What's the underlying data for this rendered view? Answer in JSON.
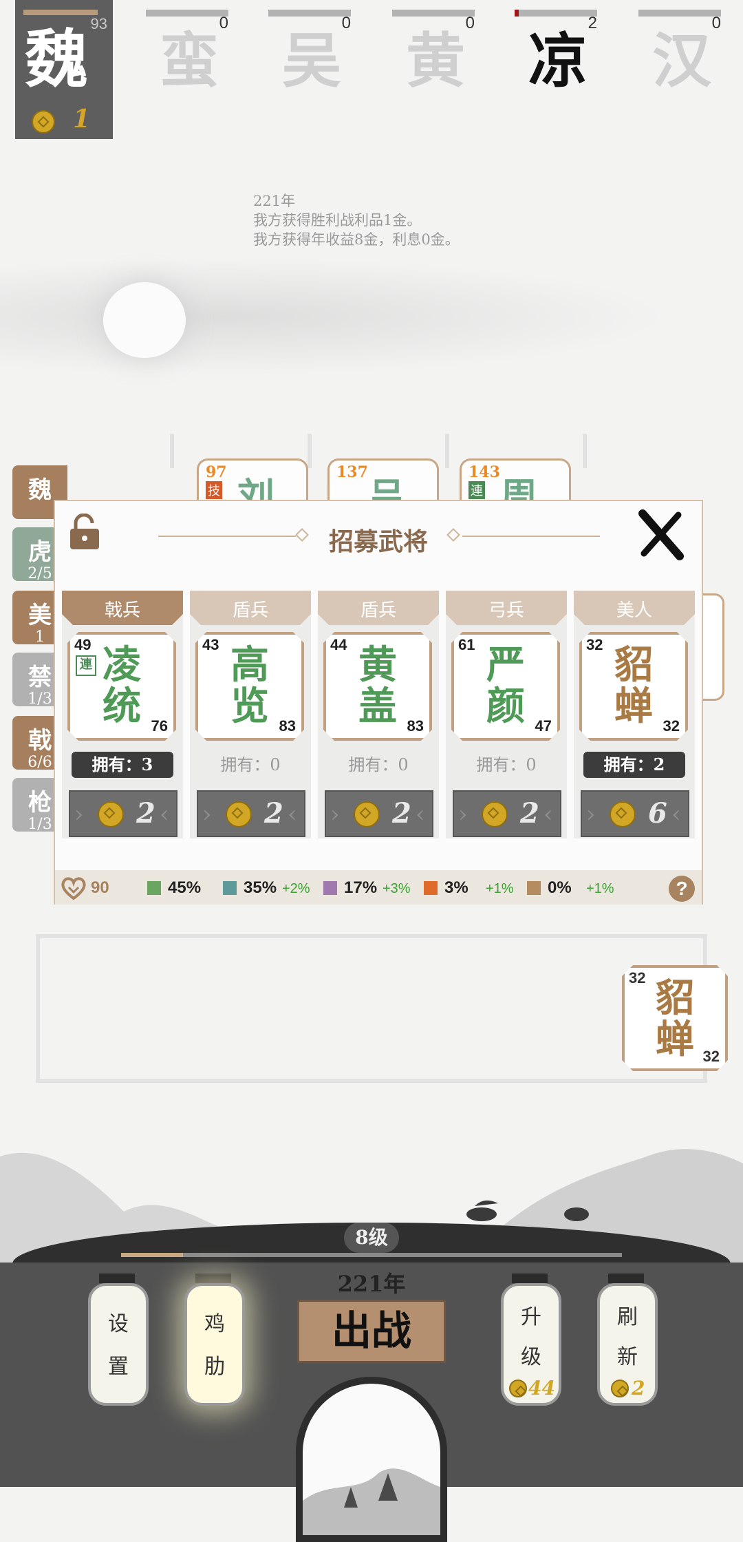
{
  "factions": [
    {
      "name": "魏",
      "hp": "93",
      "coins": "1",
      "active": true
    },
    {
      "name": "蛮",
      "hp": "0"
    },
    {
      "name": "吴",
      "hp": "0"
    },
    {
      "name": "黄",
      "hp": "0"
    },
    {
      "name": "凉",
      "hp": "2",
      "dark": true
    },
    {
      "name": "汉",
      "hp": "0"
    }
  ],
  "log": {
    "year": "221年",
    "line1": "我方获得胜利战利品1金。",
    "line2": "我方获得年收益8金，利息0金。"
  },
  "side_tags": [
    {
      "label": "魏",
      "sub": ""
    },
    {
      "label": "虎",
      "sub": "2/5"
    },
    {
      "label": "美",
      "sub": "1"
    },
    {
      "label": "禁",
      "sub": "1/3"
    },
    {
      "label": "戟",
      "sub": "6/6"
    },
    {
      "label": "枪",
      "sub": "1/3"
    }
  ],
  "bg_cards": [
    {
      "num": "97",
      "glyph": "刘",
      "badge": "技"
    },
    {
      "num": "137",
      "glyph": "吕"
    },
    {
      "num": "143",
      "glyph": "周",
      "badge": "連"
    }
  ],
  "modal": {
    "title": "招募武将",
    "generals": [
      {
        "type": "戟兵",
        "name1": "凌",
        "name2": "统",
        "atk": "49",
        "hp": "76",
        "badge": "連",
        "owned": "拥有：3",
        "has": true,
        "price": "2",
        "color": "#4f9a56",
        "ribbon": "#b08b6b"
      },
      {
        "type": "盾兵",
        "name1": "高",
        "name2": "览",
        "atk": "43",
        "hp": "83",
        "owned": "拥有：0",
        "has": false,
        "price": "2",
        "color": "#4f9a56",
        "ribbon": "#d8c7b7"
      },
      {
        "type": "盾兵",
        "name1": "黄",
        "name2": "盖",
        "atk": "44",
        "hp": "83",
        "owned": "拥有：0",
        "has": false,
        "price": "2",
        "color": "#4f9a56",
        "ribbon": "#d8c7b7"
      },
      {
        "type": "弓兵",
        "name1": "严",
        "name2": "颜",
        "atk": "61",
        "hp": "47",
        "owned": "拥有：0",
        "has": false,
        "price": "2",
        "color": "#4f9a56",
        "ribbon": "#d8c7b7"
      },
      {
        "type": "美人",
        "name1": "貂",
        "name2": "蝉",
        "atk": "32",
        "hp": "32",
        "owned": "拥有：2",
        "has": true,
        "price": "6",
        "color": "#a97a44",
        "ribbon": "#d8c7b7"
      }
    ],
    "footer": {
      "hearts": "90",
      "rates": [
        {
          "color": "#6aa661",
          "value": "45%",
          "plus": ""
        },
        {
          "color": "#5f9a9a",
          "value": "35%",
          "plus": "+2%"
        },
        {
          "color": "#a07aae",
          "value": "17%",
          "plus": "+3%"
        },
        {
          "color": "#e06a2a",
          "value": "3%",
          "plus": "+1%"
        },
        {
          "color": "#b48c60",
          "value": "0%",
          "plus": "+1%"
        }
      ]
    }
  },
  "float_card": {
    "atk": "32",
    "hp": "32",
    "name1": "貂",
    "name2": "蝉"
  },
  "bottom": {
    "level": "8级",
    "year": "221年",
    "settings": [
      "设",
      "置"
    ],
    "chicken": [
      "鸡",
      "肋"
    ],
    "go": "出战",
    "upgrade": [
      "升",
      "级"
    ],
    "upgrade_cost": "44",
    "refresh": [
      "刷",
      "新"
    ],
    "refresh_cost": "2"
  }
}
